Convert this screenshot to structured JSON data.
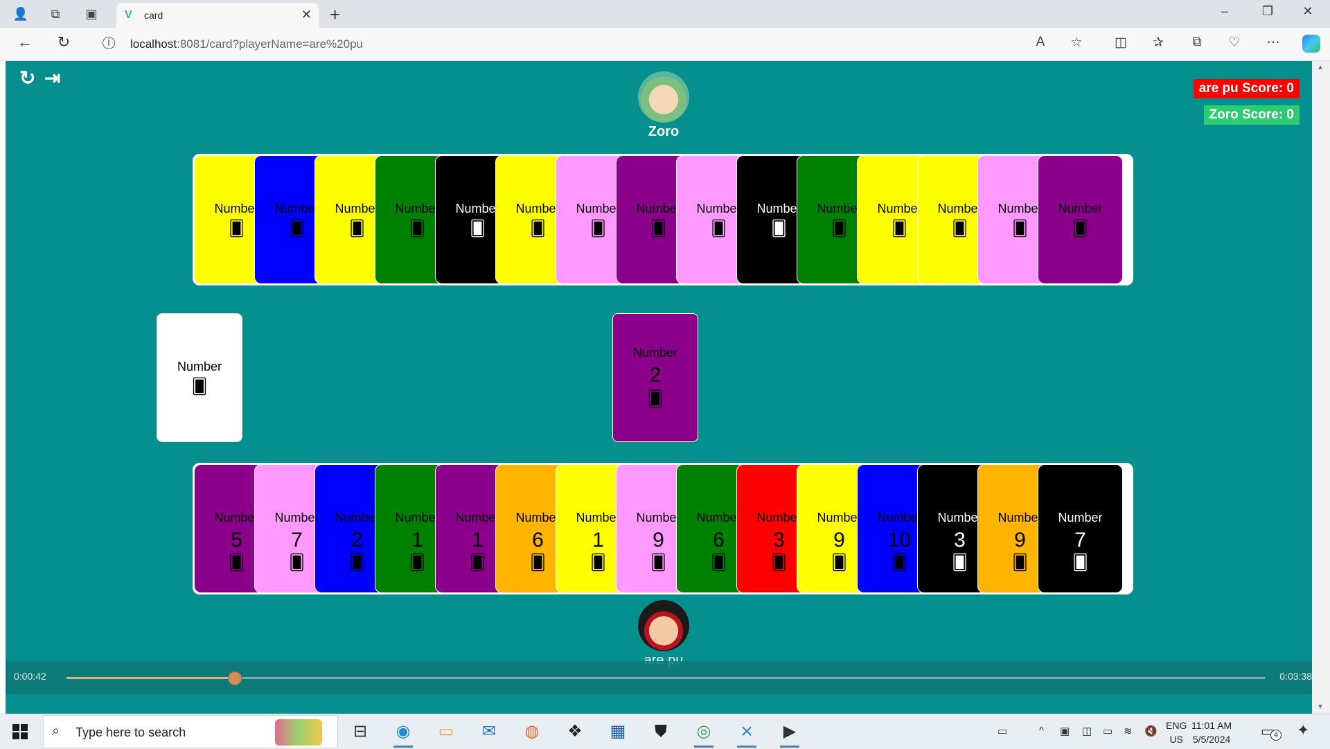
{
  "browser": {
    "tab_title": "card",
    "address_host": "localhost",
    "address_rest": ":8081/card?playerName=are%20pu"
  },
  "game": {
    "opponent": {
      "name": "Zoro"
    },
    "player": {
      "name": "are pu"
    },
    "scores": {
      "player_label": "are pu Score: 0",
      "opponent_label": "Zoro Score: 0",
      "player_color": "#ff0000",
      "opponent_color": "#2ecc71"
    },
    "opponent_hand": [
      {
        "kind": "Number",
        "color": "#ffff00",
        "text": "#000"
      },
      {
        "kind": "Number",
        "color": "#0000ff",
        "text": "#000"
      },
      {
        "kind": "Number",
        "color": "#ffff00",
        "text": "#000"
      },
      {
        "kind": "Number",
        "color": "#008000",
        "text": "#000"
      },
      {
        "kind": "Number",
        "color": "#000000",
        "text": "#fff"
      },
      {
        "kind": "Number",
        "color": "#ffff00",
        "text": "#000"
      },
      {
        "kind": "Number",
        "color": "#ff99ff",
        "text": "#000"
      },
      {
        "kind": "Number",
        "color": "#8b008b",
        "text": "#000"
      },
      {
        "kind": "Number",
        "color": "#ff99ff",
        "text": "#000"
      },
      {
        "kind": "Number",
        "color": "#000000",
        "text": "#fff"
      },
      {
        "kind": "Number",
        "color": "#008000",
        "text": "#000"
      },
      {
        "kind": "Number",
        "color": "#ffff00",
        "text": "#000"
      },
      {
        "kind": "Number",
        "color": "#ffff00",
        "text": "#000"
      },
      {
        "kind": "Number",
        "color": "#ff99ff",
        "text": "#000"
      },
      {
        "kind": "Number",
        "color": "#8b008b",
        "text": "#000"
      }
    ],
    "player_hand": [
      {
        "kind": "Number",
        "value": "5",
        "color": "#8b008b",
        "text": "#000"
      },
      {
        "kind": "Number",
        "value": "7",
        "color": "#ff99ff",
        "text": "#000"
      },
      {
        "kind": "Number",
        "value": "2",
        "color": "#0000ff",
        "text": "#000"
      },
      {
        "kind": "Number",
        "value": "1",
        "color": "#008000",
        "text": "#000"
      },
      {
        "kind": "Number",
        "value": "1",
        "color": "#8b008b",
        "text": "#000"
      },
      {
        "kind": "Number",
        "value": "6",
        "color": "#ffb400",
        "text": "#000"
      },
      {
        "kind": "Number",
        "value": "1",
        "color": "#ffff00",
        "text": "#000"
      },
      {
        "kind": "Number",
        "value": "9",
        "color": "#ff99ff",
        "text": "#000"
      },
      {
        "kind": "Number",
        "value": "6",
        "color": "#008000",
        "text": "#000"
      },
      {
        "kind": "Number",
        "value": "3",
        "color": "#ff0000",
        "text": "#000"
      },
      {
        "kind": "Number",
        "value": "9",
        "color": "#ffff00",
        "text": "#000"
      },
      {
        "kind": "Number",
        "value": "10",
        "color": "#0000ff",
        "text": "#000"
      },
      {
        "kind": "Number",
        "value": "3",
        "color": "#000000",
        "text": "#fff"
      },
      {
        "kind": "Number",
        "value": "9",
        "color": "#ffb400",
        "text": "#000"
      },
      {
        "kind": "Number",
        "value": "7",
        "color": "#000000",
        "text": "#fff"
      }
    ],
    "deck": {
      "kind": "Number",
      "color": "#ffffff"
    },
    "discard": {
      "kind": "Number",
      "value": "2",
      "color": "#8b008b"
    },
    "card_icon": "cards-icon",
    "card_glyph": "🂠"
  },
  "video": {
    "elapsed": "0:00:42",
    "total": "0:03:38",
    "progress": 0.14
  },
  "taskbar": {
    "search_placeholder": "Type here to search",
    "lang_top": "ENG",
    "lang_bottom": "US",
    "time": "11:01 AM",
    "date": "5/5/2024",
    "notification_count": "4"
  }
}
